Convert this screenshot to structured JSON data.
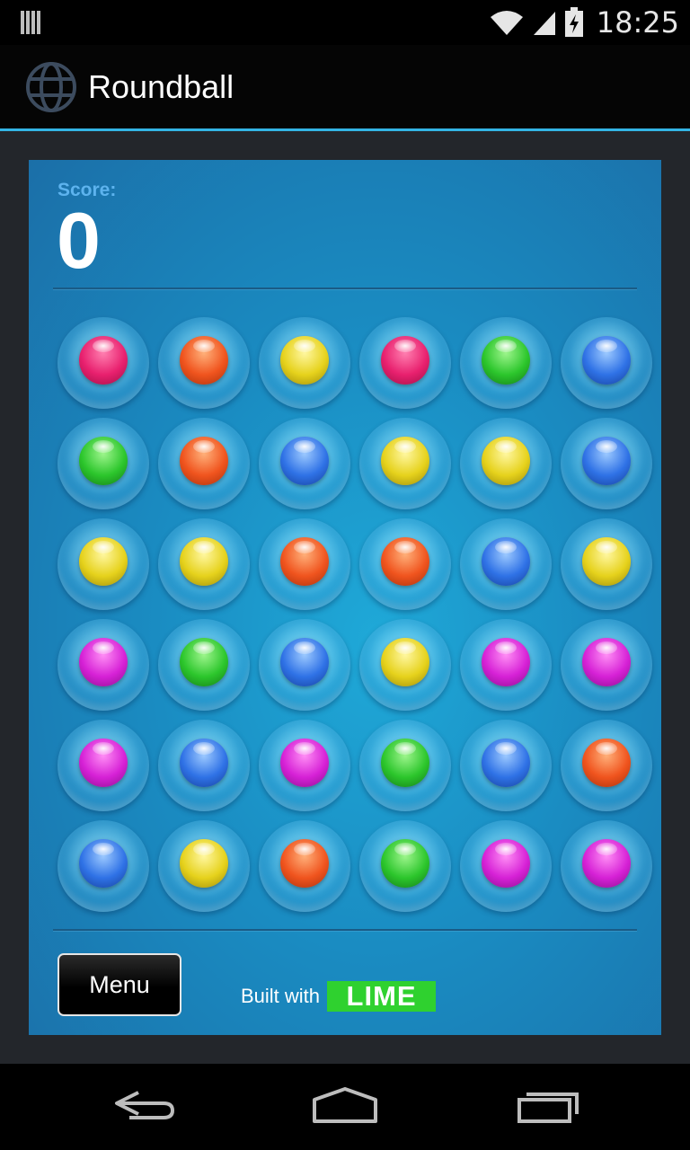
{
  "status_bar": {
    "time": "18:25"
  },
  "app": {
    "title": "Roundball"
  },
  "game": {
    "score_label": "Score:",
    "score": "0",
    "grid": [
      [
        "pink",
        "orange",
        "yellow",
        "pink",
        "green",
        "blue"
      ],
      [
        "green",
        "orange",
        "blue",
        "yellow",
        "yellow",
        "blue"
      ],
      [
        "yellow",
        "yellow",
        "orange",
        "orange",
        "blue",
        "yellow"
      ],
      [
        "magenta",
        "green",
        "blue",
        "yellow",
        "magenta",
        "magenta"
      ],
      [
        "magenta",
        "blue",
        "magenta",
        "green",
        "blue",
        "orange"
      ],
      [
        "blue",
        "yellow",
        "orange",
        "green",
        "magenta",
        "magenta"
      ]
    ],
    "menu_label": "Menu",
    "built_with": "Built with",
    "lime_logo": "LIME"
  },
  "colors": {
    "accent": "#33b5e5",
    "board": "#1a8cc2",
    "lime": "#2fd12f"
  },
  "nav": {
    "back_icon": "back-arrow-icon",
    "home_icon": "home-icon",
    "recents_icon": "recent-apps-icon"
  }
}
